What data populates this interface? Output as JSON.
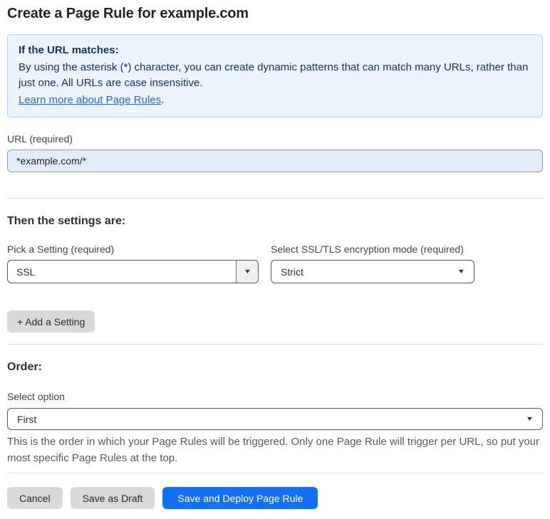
{
  "page": {
    "title": "Create a Page Rule for example.com"
  },
  "info_box": {
    "heading": "If the URL matches:",
    "body": "By using the asterisk (*) character, you can create dynamic patterns that can match many URLs, rather than just one. All URLs are case insensitive.",
    "link_label": "Learn more about Page Rules",
    "link_suffix": "."
  },
  "url_field": {
    "label": "URL (required)",
    "value": "*example.com/*"
  },
  "settings_section": {
    "heading": "Then the settings are:",
    "setting_picker": {
      "label": "Pick a Setting (required)",
      "value": "SSL"
    },
    "ssl_mode_picker": {
      "label": "Select SSL/TLS encryption mode (required)",
      "value": "Strict"
    },
    "add_setting_label": "+ Add a Setting"
  },
  "order_section": {
    "heading": "Order:",
    "select_label": "Select option",
    "value": "First",
    "help_text": "This is the order in which your Page Rules will be triggered. Only one Page Rule will trigger per URL, so put your most specific Page Rules at the top."
  },
  "footer": {
    "cancel_label": "Cancel",
    "save_draft_label": "Save as Draft",
    "save_deploy_label": "Save and Deploy Page Rule"
  },
  "colors": {
    "accent_blue": "#1570EF",
    "info_box_bg": "#EBF3FC",
    "info_box_border": "#AFD2F1",
    "info_text_navy": "#16325C",
    "link_blue": "#2A65C5",
    "url_input_bg": "#E2ECFA",
    "button_gray": "#D9D9D9"
  },
  "icons": {
    "dropdown_arrow": "▼"
  }
}
